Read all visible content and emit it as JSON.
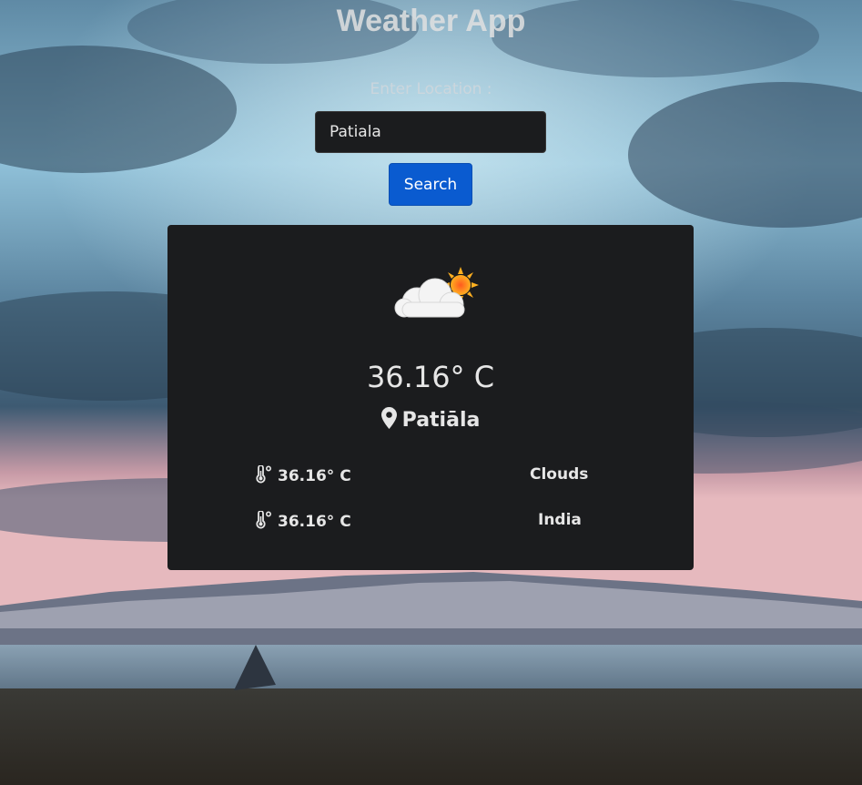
{
  "app": {
    "title": "Weather App"
  },
  "search": {
    "label": "Enter Location :",
    "input_value": "Patiala",
    "button_label": "Search"
  },
  "weather": {
    "icon": "partly-cloudy-icon",
    "temperature": "36.16° C",
    "city": "Patiāla",
    "details": {
      "temp_1": "36.16° C",
      "condition": "Clouds",
      "temp_2": "36.16° C",
      "country": "India"
    }
  },
  "colors": {
    "card_bg": "#1b1c1e",
    "button_bg": "#0a5bd0",
    "text": "#e6e6e6"
  }
}
